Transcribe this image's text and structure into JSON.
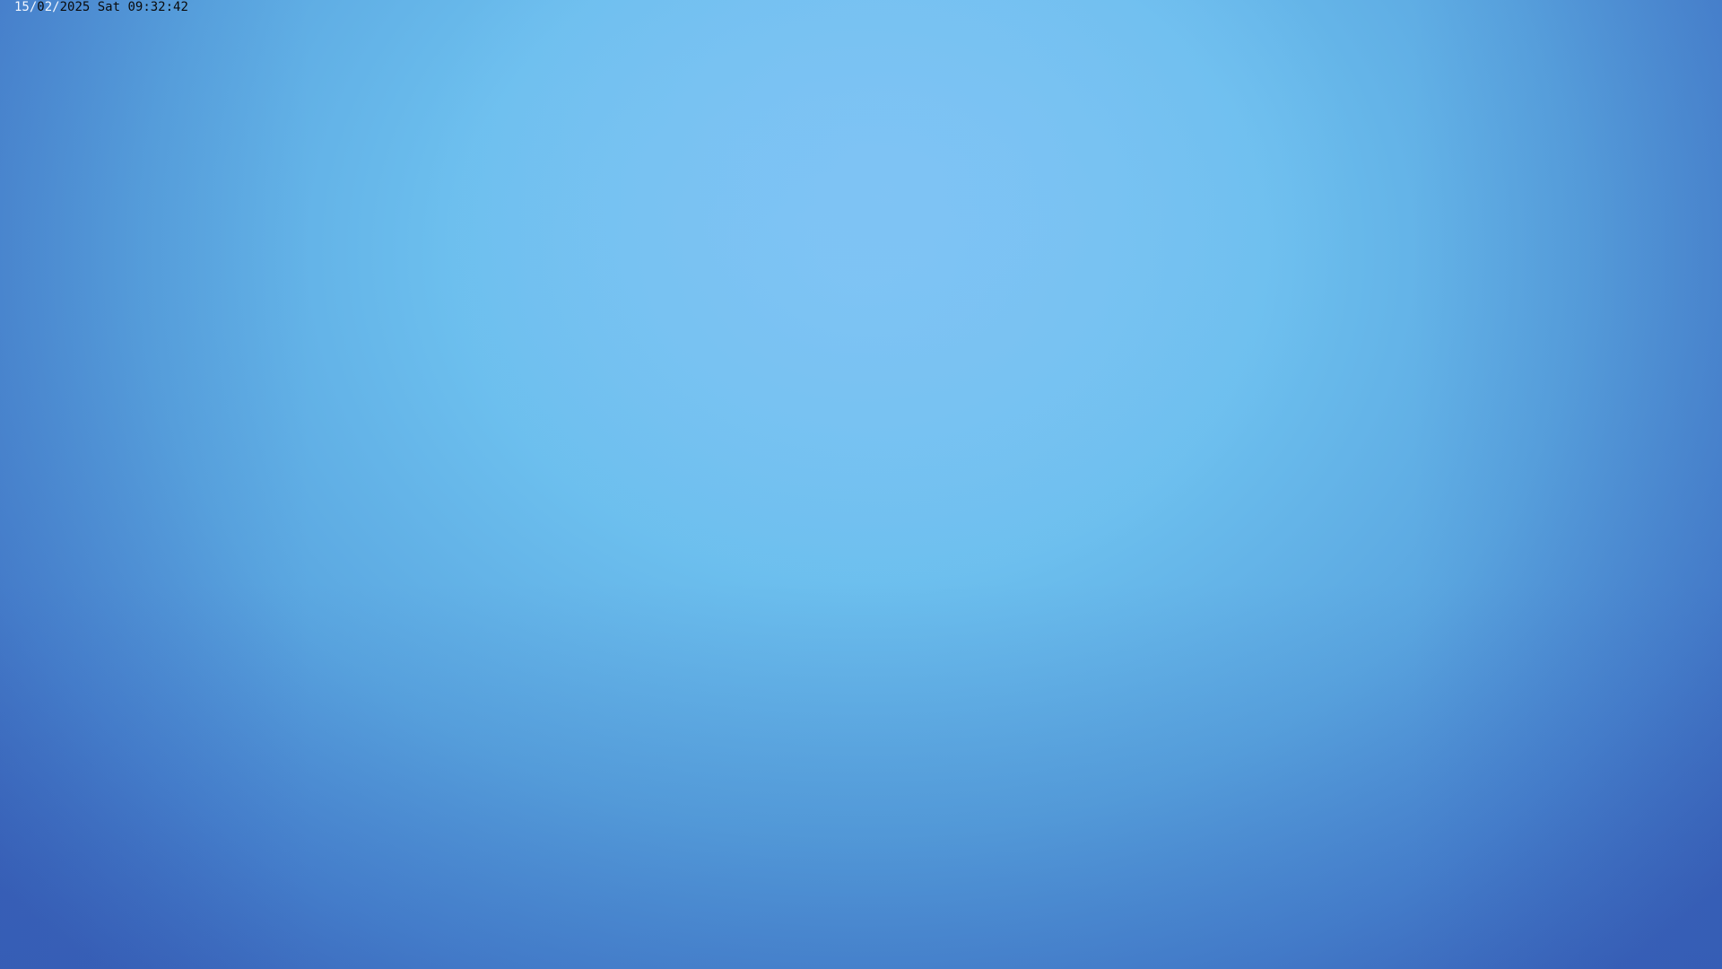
{
  "osd": {
    "day": "15",
    "sep1": "/",
    "month_a": "0",
    "month_b": "2",
    "sep2": "/",
    "rest": "2025 Sat 09:32:42",
    "text_dark_color": "#0a0a0a",
    "text_light_color": "#f4f8ff"
  },
  "scene": {
    "sky_center_color": "#7ac4f2",
    "sky_edge_color": "#3e67bd"
  }
}
